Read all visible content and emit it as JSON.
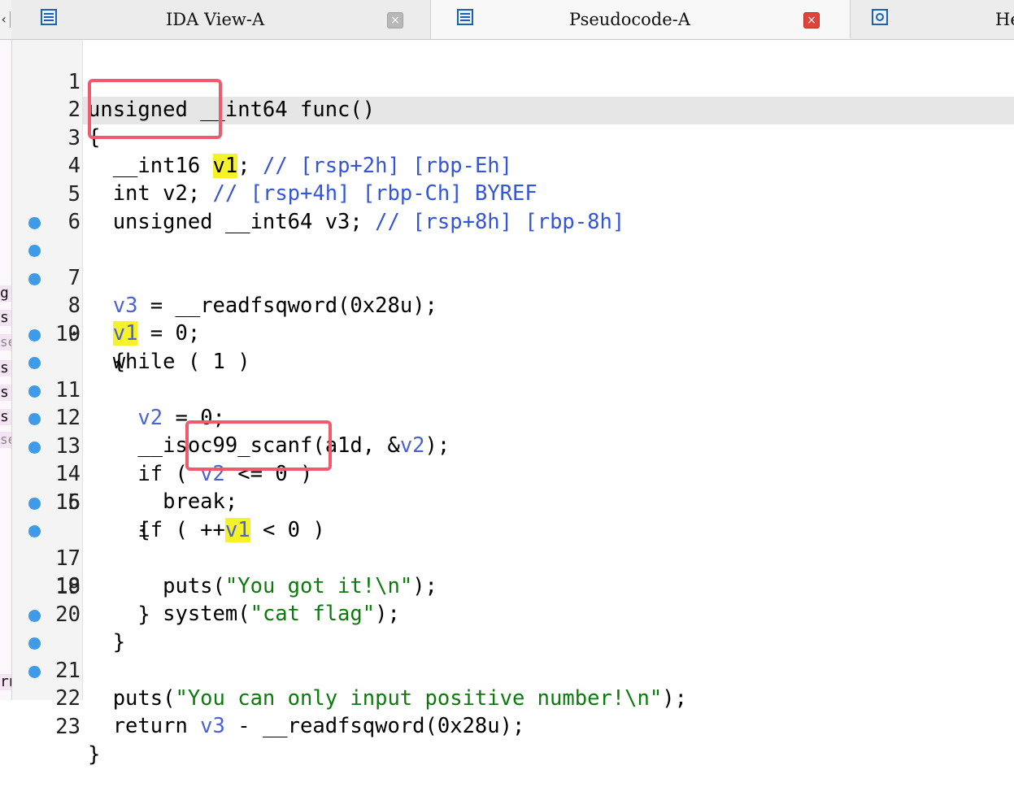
{
  "tabs": [
    {
      "label": "IDA View-A",
      "icon": "disassembly-icon",
      "active": false,
      "close": "×"
    },
    {
      "label": "Pseudocode-A",
      "icon": "pseudocode-icon",
      "active": true,
      "close": "×"
    },
    {
      "label": "He",
      "icon": "hex-view-icon",
      "active": false
    }
  ],
  "left_strip": [
    "g",
    "s",
    "se",
    "s",
    "s",
    "s",
    "se",
    "rn"
  ],
  "accent_colors": {
    "breakpoint": "#3d9be9",
    "annotation": "#f05a6c",
    "highlight": "#f5f22a"
  },
  "code": {
    "line_numbers": [
      "1",
      "2",
      "3",
      "4",
      "5",
      "6",
      "7",
      "8",
      "9",
      "10",
      "11",
      "12",
      "13",
      "14",
      "15",
      "16",
      "17",
      "18",
      "19",
      "20",
      "21",
      "22",
      "23"
    ],
    "breakpoint_lines": [
      7,
      8,
      9,
      11,
      12,
      13,
      14,
      15,
      17,
      18,
      21,
      22,
      23
    ],
    "l1": "unsigned __int64 func()",
    "l2": "{",
    "l3": {
      "a": "  __int16 ",
      "v": "v1",
      "b": ";",
      "c": " // [rsp+2h] [rbp-Eh]"
    },
    "l4": {
      "a": "  int ",
      "v": "v2",
      "b": ";",
      "c": " // [rsp+4h] [rbp-Ch] BYREF"
    },
    "l5": {
      "a": "  unsigned __int64 ",
      "v": "v3",
      "b": ";",
      "c": " // [rsp+8h] [rbp-8h]"
    },
    "l6": "",
    "l7": {
      "a": "  ",
      "v": "v3",
      "b": " = __readfsqword(0x28u);"
    },
    "l8": {
      "a": "  ",
      "v": "v1",
      "b": " = 0;"
    },
    "l9": "  while ( 1 )",
    "l10": "  {",
    "l11": {
      "a": "    ",
      "v": "v2",
      "b": " = 0;"
    },
    "l12": {
      "a": "    __isoc99_scanf(a1d, &",
      "v": "v2",
      "b": ");"
    },
    "l13": {
      "a": "    if ( ",
      "v": "v2",
      "b": " <= 0 )"
    },
    "l14": "      break;",
    "l15": {
      "a": "    if ( ++",
      "v": "v1",
      "b": " < 0 )"
    },
    "l16": "    {",
    "l17": {
      "a": "      puts(",
      "s": "\"You got it!\\n\"",
      "b": ");"
    },
    "l18": {
      "a": "      system(",
      "s": "\"cat flag\"",
      "b": ");"
    },
    "l19": "    }",
    "l20": "  }",
    "l21": {
      "a": "  puts(",
      "s": "\"You can only input positive number!\\n\"",
      "b": ");"
    },
    "l22": {
      "a": "  return ",
      "v": "v3",
      "b": " - __readfsqword(0x28u);"
    },
    "l23": "}"
  }
}
